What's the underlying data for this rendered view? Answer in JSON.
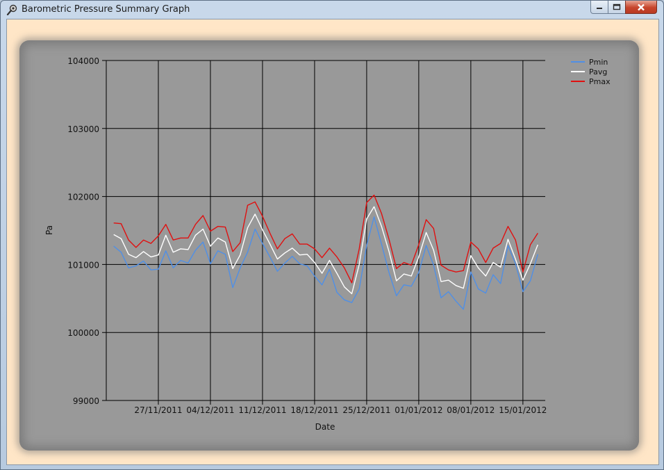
{
  "window": {
    "title": "Barometric Pressure Summary Graph",
    "icons": {
      "app": "barometer-icon",
      "minimize": "minimize-icon",
      "maximize": "maximize-icon",
      "close": "close-icon"
    }
  },
  "colors": {
    "client_background": "#ffe6c7",
    "plot_background": "#999999",
    "pmin": "#4f8fe6",
    "pavg": "#ffffff",
    "pmax": "#e01010"
  },
  "chart_data": {
    "type": "line",
    "title": "",
    "xlabel": "Date",
    "ylabel": "Pa",
    "ylim": [
      99000,
      104000
    ],
    "yticks": [
      99000,
      100000,
      101000,
      102000,
      103000,
      104000
    ],
    "xtick_labels": [
      "27/11/2011",
      "04/12/2011",
      "11/12/2011",
      "18/12/2011",
      "25/12/2011",
      "01/01/2012",
      "08/01/2012",
      "15/01/2012"
    ],
    "xtick_days": [
      7,
      14,
      21,
      28,
      35,
      42,
      49,
      56
    ],
    "x_range_days": [
      1,
      58
    ],
    "grid": true,
    "legend_position": "top-right",
    "series": [
      {
        "name": "Pmin",
        "color": "#4f8fe6",
        "values": [
          101270,
          101180,
          100950,
          100980,
          101050,
          100920,
          100930,
          101200,
          100950,
          101060,
          101020,
          101210,
          101330,
          101010,
          101200,
          101150,
          100660,
          100950,
          101180,
          101520,
          101310,
          101110,
          100900,
          101020,
          101120,
          101010,
          100980,
          100830,
          100700,
          100930,
          100590,
          100480,
          100440,
          100640,
          101280,
          101700,
          101300,
          100880,
          100540,
          100700,
          100680,
          100880,
          101280,
          100990,
          100510,
          100600,
          100460,
          100340,
          100890,
          100640,
          100580,
          100850,
          100720,
          101280,
          101010,
          100600,
          100760,
          101150
        ]
      },
      {
        "name": "Pavg",
        "color": "#ffffff",
        "values": [
          101440,
          101380,
          101150,
          101100,
          101190,
          101110,
          101140,
          101430,
          101180,
          101230,
          101220,
          101430,
          101520,
          101270,
          101390,
          101330,
          100940,
          101140,
          101540,
          101740,
          101510,
          101300,
          101080,
          101170,
          101240,
          101140,
          101150,
          101030,
          100870,
          101060,
          100870,
          100670,
          100570,
          101000,
          101670,
          101850,
          101560,
          101190,
          100760,
          100860,
          100830,
          101110,
          101470,
          101210,
          100750,
          100770,
          100690,
          100650,
          101130,
          100950,
          100830,
          101030,
          100960,
          101370,
          101080,
          100770,
          101010,
          101290
        ]
      },
      {
        "name": "Pmax",
        "color": "#e01010",
        "values": [
          101610,
          101600,
          101360,
          101250,
          101360,
          101310,
          101420,
          101590,
          101360,
          101390,
          101390,
          101590,
          101720,
          101490,
          101560,
          101550,
          101190,
          101320,
          101870,
          101920,
          101710,
          101460,
          101230,
          101380,
          101450,
          101300,
          101300,
          101230,
          101100,
          101240,
          101110,
          100950,
          100730,
          101230,
          101910,
          102020,
          101750,
          101370,
          100940,
          101030,
          100990,
          101290,
          101660,
          101530,
          100990,
          100920,
          100890,
          100910,
          101330,
          101230,
          101030,
          101240,
          101310,
          101560,
          101360,
          100890,
          101290,
          101460
        ]
      }
    ]
  }
}
